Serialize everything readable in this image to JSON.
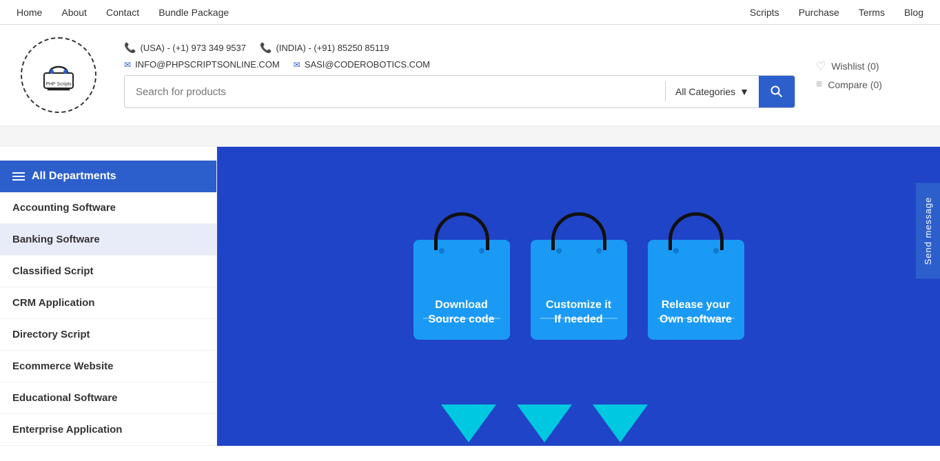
{
  "topnav": {
    "left_items": [
      {
        "label": "Home",
        "id": "home"
      },
      {
        "label": "About",
        "id": "about"
      },
      {
        "label": "Contact",
        "id": "contact"
      },
      {
        "label": "Bundle Package",
        "id": "bundle"
      }
    ],
    "right_items": [
      {
        "label": "Scripts",
        "id": "scripts"
      },
      {
        "label": "Purchase",
        "id": "purchase"
      },
      {
        "label": "Terms",
        "id": "terms"
      },
      {
        "label": "Blog",
        "id": "blog"
      }
    ]
  },
  "header": {
    "phone_usa": "(USA) - (+1) 973 349 9537",
    "phone_india": "(INDIA) - (+91) 85250 85119",
    "email1": "INFO@PHPSCRIPTSONLINE.COM",
    "email2": "SASI@CODEROBOTICS.COM",
    "search_placeholder": "Search for products",
    "category_label": "All Categories",
    "wishlist_label": "Wishlist (0)",
    "compare_label": "Compare (0)"
  },
  "sidebar": {
    "header_label": "All Departments",
    "items": [
      {
        "label": "Accounting Software",
        "id": "accounting",
        "active": false
      },
      {
        "label": "Banking Software",
        "id": "banking",
        "active": true
      },
      {
        "label": "Classified Script",
        "id": "classified",
        "active": false
      },
      {
        "label": "CRM Application",
        "id": "crm",
        "active": false
      },
      {
        "label": "Directory Script",
        "id": "directory",
        "active": false
      },
      {
        "label": "Ecommerce Website",
        "id": "ecommerce",
        "active": false
      },
      {
        "label": "Educational Software",
        "id": "educational",
        "active": false
      },
      {
        "label": "Enterprise Application",
        "id": "enterprise",
        "active": false
      }
    ]
  },
  "hero": {
    "bags": [
      {
        "label": "Download\nSource code"
      },
      {
        "label": "Customize it\nIf needed"
      },
      {
        "label": "Release your\nOwn software"
      }
    ]
  },
  "send_message": {
    "label": "Send message"
  }
}
